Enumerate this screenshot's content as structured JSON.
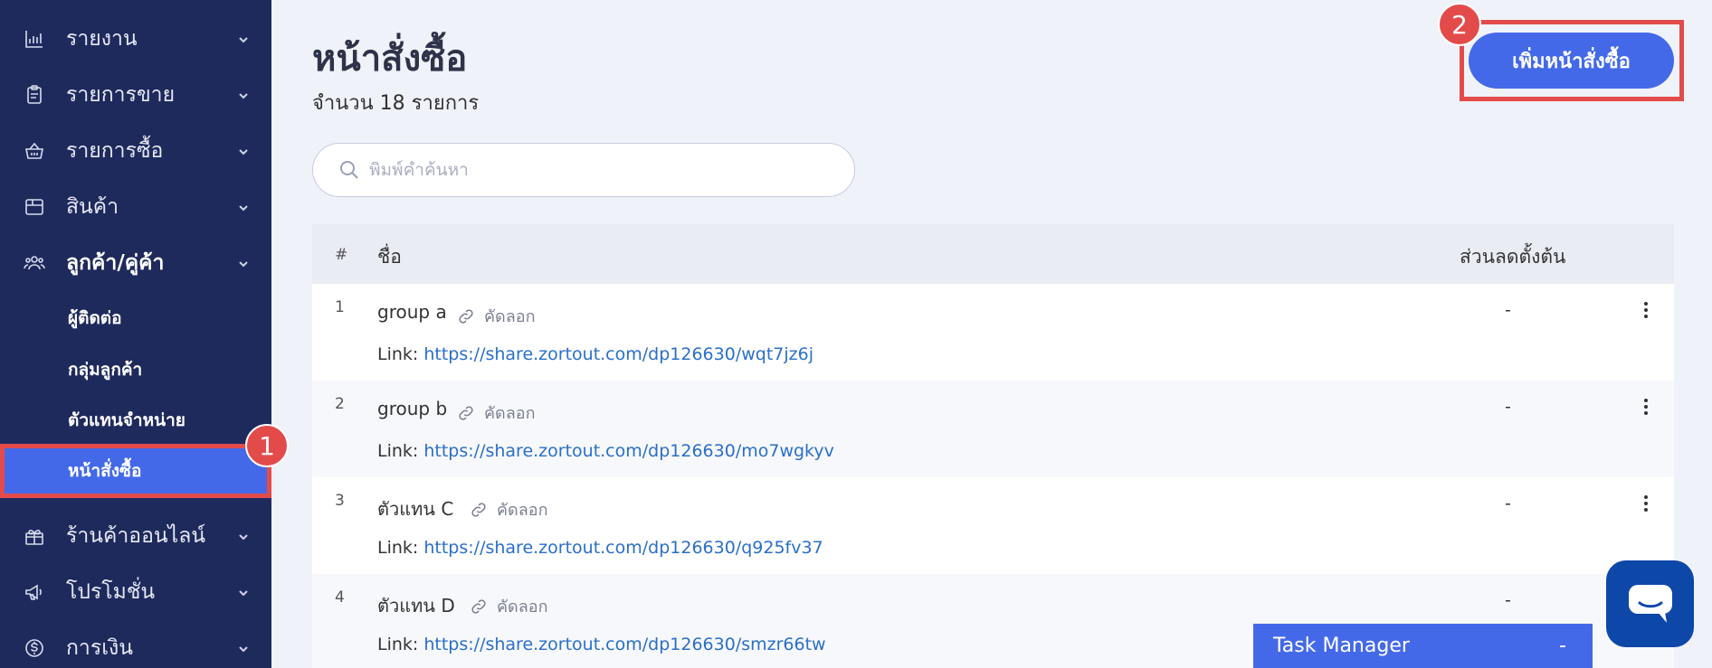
{
  "sidebar": {
    "items": [
      {
        "label": "รายงาน",
        "icon": "bar-chart-icon"
      },
      {
        "label": "รายการขาย",
        "icon": "clipboard-icon"
      },
      {
        "label": "รายการซื้อ",
        "icon": "basket-icon"
      },
      {
        "label": "สินค้า",
        "icon": "box-icon"
      },
      {
        "label": "ลูกค้า/คู่ค้า",
        "icon": "users-icon"
      },
      {
        "label": "ร้านค้าออนไลน์",
        "icon": "gift-icon"
      },
      {
        "label": "โปรโมชั่น",
        "icon": "megaphone-icon"
      },
      {
        "label": "การเงิน",
        "icon": "dollar-icon"
      }
    ],
    "subitems": [
      {
        "label": "ผู้ติดต่อ"
      },
      {
        "label": "กลุ่มลูกค้า"
      },
      {
        "label": "ตัวแทนจำหน่าย"
      },
      {
        "label": "หน้าสั่งซื้อ",
        "active": true
      }
    ]
  },
  "annotations": {
    "badge1": "1",
    "badge2": "2",
    "color": "#e34b4b"
  },
  "header": {
    "title": "หน้าสั่งซื้อ",
    "count": "จำนวน 18 รายการ",
    "add_button": "เพิ่มหน้าสั่งซื้อ"
  },
  "search": {
    "placeholder": "พิมพ์คำค้นหา"
  },
  "table": {
    "columns": {
      "num": "#",
      "name": "ชื่อ",
      "discount": "ส่วนลดตั้งต้น"
    },
    "copy_label": "คัดลอก",
    "link_prefix": "Link: ",
    "rows": [
      {
        "num": "1",
        "name": "group a",
        "link": "https://share.zortout.com/dp126630/wqt7jz6j",
        "discount": "-"
      },
      {
        "num": "2",
        "name": "group b",
        "link": "https://share.zortout.com/dp126630/mo7wgkyv",
        "discount": "-"
      },
      {
        "num": "3",
        "name": "ตัวแทน C",
        "link": "https://share.zortout.com/dp126630/q925fv37",
        "discount": "-"
      },
      {
        "num": "4",
        "name": "ตัวแทน D",
        "link": "https://share.zortout.com/dp126630/smzr66tw",
        "discount": "-"
      }
    ]
  },
  "task_manager": {
    "label": "Task Manager",
    "minimize": "-"
  },
  "colors": {
    "sidebar_bg": "#1f2a5c",
    "accent": "#4469e8",
    "link": "#2a6fc9",
    "chat": "#0d47a8"
  }
}
